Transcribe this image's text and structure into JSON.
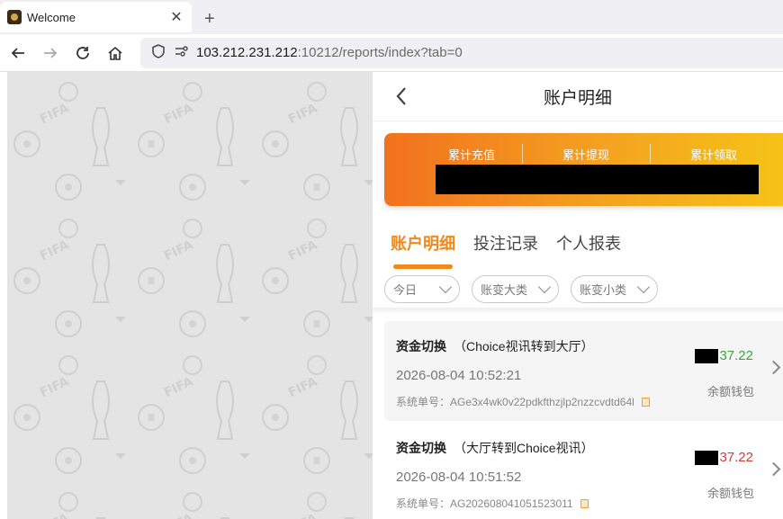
{
  "browser": {
    "tab_title": "Welcome",
    "url_host": "103.212.231.212",
    "url_rest": ":10212/reports/index?tab=0"
  },
  "header": {
    "title": "账户明细"
  },
  "summary": {
    "items": [
      {
        "label": "累计充值"
      },
      {
        "label": "累计提现"
      },
      {
        "label": "累计领取"
      }
    ]
  },
  "tabs": [
    {
      "label": "账户明细",
      "active": true
    },
    {
      "label": "投注记录",
      "active": false
    },
    {
      "label": "个人报表",
      "active": false
    }
  ],
  "filters": [
    {
      "label": "今日"
    },
    {
      "label": "账变大类"
    },
    {
      "label": "账变小类"
    }
  ],
  "records": [
    {
      "type": "资金切换",
      "desc": "（Choice视讯转到大厅）",
      "time": "2026-08-04 10:52:21",
      "order": "系统单号：AGe3x4wk0v22pdkfthzjlp2nzzcvdtd64l",
      "amount": "37.22",
      "amount_color": "#3aa63a",
      "wallet": "余额钱包"
    },
    {
      "type": "资金切换",
      "desc": "（大厅转到Choice视讯）",
      "time": "2026-08-04 10:51:52",
      "order": "系统单号：AG202608041051523011",
      "amount": "37.22",
      "amount_color": "#d23c3c",
      "wallet": "余额钱包"
    }
  ]
}
